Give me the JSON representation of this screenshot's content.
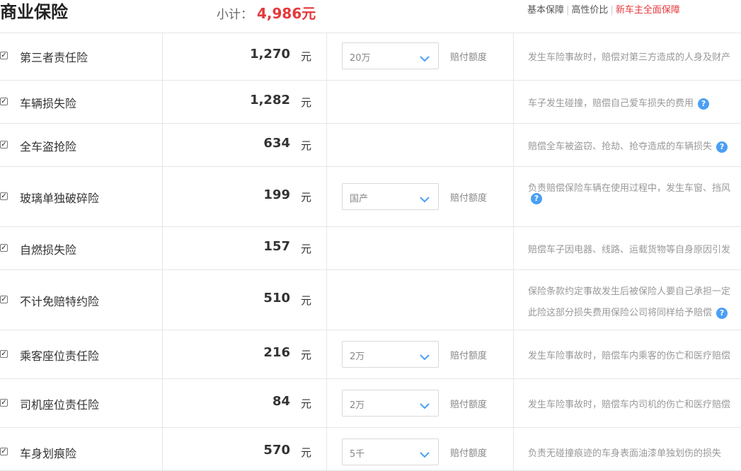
{
  "header": {
    "title": "商业保险",
    "subtotal_label": "小计：",
    "subtotal_value": "4,986元",
    "plans": [
      "基本保障",
      "高性价比",
      "新车主全面保障"
    ],
    "active_plan": "新车主全面保障"
  },
  "colors": {
    "accent_red": "#e4393c",
    "help_blue": "#4a9ff5",
    "border": "#e6e6e6"
  },
  "icons": {
    "select_caret": "chevron-down-icon",
    "help": "help-icon",
    "checkbox": "checkbox-checked"
  },
  "rows": [
    {
      "name": "第三者责任险",
      "price": "1,270",
      "unit": "元",
      "select": "20万",
      "coverage_label": "赔付额度",
      "desc": "发生车险事故时，赔偿对第三方造成的人身及财产",
      "desc2": ""
    },
    {
      "name": "车辆损失险",
      "price": "1,282",
      "unit": "元",
      "select": "",
      "coverage_label": "",
      "desc": "车子发生碰撞，赔偿自己爱车损失的费用",
      "desc2": ""
    },
    {
      "name": "全车盗抢险",
      "price": "634",
      "unit": "元",
      "select": "",
      "coverage_label": "",
      "desc": "赔偿全车被盗窃、抢劫、抢夺造成的车辆损失",
      "desc2": ""
    },
    {
      "name": "玻璃单独破碎险",
      "price": "199",
      "unit": "元",
      "select": "国产",
      "coverage_label": "赔付额度",
      "desc": "负责赔偿保险车辆在使用过程中，发生车窗、挡风",
      "desc2": ""
    },
    {
      "name": "自燃损失险",
      "price": "157",
      "unit": "元",
      "select": "",
      "coverage_label": "",
      "desc": "赔偿车子因电器、线路、运载货物等自身原因引发",
      "desc2": ""
    },
    {
      "name": "不计免赔特约险",
      "price": "510",
      "unit": "元",
      "select": "",
      "coverage_label": "",
      "desc": "保险条款约定事故发生后被保险人要自己承担一定",
      "desc2": "此险这部分损失费用保险公司将同样给予赔偿"
    },
    {
      "name": "乘客座位责任险",
      "price": "216",
      "unit": "元",
      "select": "2万",
      "coverage_label": "赔付额度",
      "desc": "发生车险事故时，赔偿车内乘客的伤亡和医疗赔偿",
      "desc2": ""
    },
    {
      "name": "司机座位责任险",
      "price": "84",
      "unit": "元",
      "select": "2万",
      "coverage_label": "赔付额度",
      "desc": "发生车险事故时，赔偿车内司机的伤亡和医疗赔偿",
      "desc2": ""
    },
    {
      "name": "车身划痕险",
      "price": "570",
      "unit": "元",
      "select": "5千",
      "coverage_label": "赔付额度",
      "desc": "负责无碰撞痕迹的车身表面油漆单独划伤的损失",
      "desc2": ""
    }
  ]
}
